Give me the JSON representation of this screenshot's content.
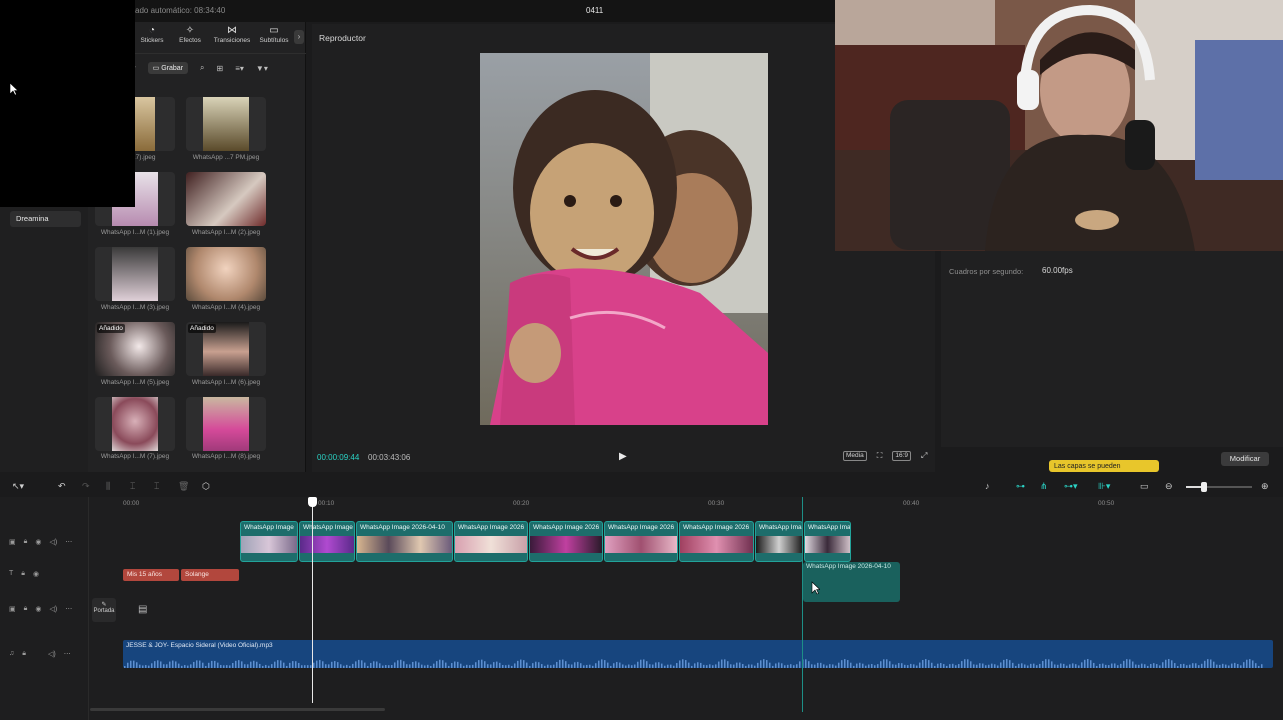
{
  "header": {
    "autosave": "ado automático: 08:34:40",
    "project_title": "0411"
  },
  "toolbar_tabs": [
    {
      "label": "Stickers",
      "icon": "sticker-icon"
    },
    {
      "label": "Efectos",
      "icon": "effects-icon"
    },
    {
      "label": "Transiciones",
      "icon": "transitions-icon"
    },
    {
      "label": "Subtítulos",
      "icon": "subtitles-icon"
    }
  ],
  "media_tools": {
    "record_label": "Grabar",
    "partial_label": "r"
  },
  "sidebar": {
    "items": [
      {
        "label": "Dreamina"
      }
    ]
  },
  "media": {
    "items": [
      {
        "label": "...(17).jpeg",
        "added": ""
      },
      {
        "label": "WhatsApp ...7 PM.jpeg",
        "added": ""
      },
      {
        "label": "WhatsApp I...M (1).jpeg",
        "added": ""
      },
      {
        "label": "WhatsApp I...M (2).jpeg",
        "added": ""
      },
      {
        "label": "WhatsApp I...M (3).jpeg",
        "added": ""
      },
      {
        "label": "WhatsApp I...M (4).jpeg",
        "added": ""
      },
      {
        "label": "WhatsApp I...M (5).jpeg",
        "added": "Añadido"
      },
      {
        "label": "WhatsApp I...M (6).jpeg",
        "added": "Añadido"
      },
      {
        "label": "WhatsApp I...M (7).jpeg",
        "added": ""
      },
      {
        "label": "WhatsApp I...M (8).jpeg",
        "added": ""
      }
    ]
  },
  "player": {
    "title": "Reproductor",
    "current_time": "00:00:09:44",
    "total_time": "00:03:43:06",
    "media_btn": "Media",
    "ratio_btn": "16:9"
  },
  "details": {
    "fps_label": "Cuadros por segundo:",
    "fps_value": "60.00fps",
    "tooltip": "Las capas se pueden",
    "modify_label": "Modificar"
  },
  "timeline": {
    "ticks": [
      "00:00",
      "00:10",
      "00:20",
      "00:30",
      "00:40",
      "00:50"
    ],
    "video_clips": [
      "WhatsApp Image",
      "WhatsApp Image",
      "WhatsApp Image 2026-04-10",
      "WhatsApp Image 2026",
      "WhatsApp Image 2026",
      "WhatsApp Image 2026",
      "WhatsApp Image 2026",
      "WhatsApp Ima",
      "WhatsApp Ima"
    ],
    "text_clips": [
      "Mis 15 años",
      "Solange"
    ],
    "dragging_clip": "WhatsApp Image 2026-04-10",
    "cover_label": "Portada",
    "audio_label": "JESSE & JOY- Espacio Sideral (Video Oficial).mp3"
  },
  "colors": {
    "accent": "#2bd3c5",
    "clip": "#1d6d6b",
    "text_clip": "#b2473d",
    "audio": "#17457e",
    "tooltip": "#e8c62b"
  }
}
